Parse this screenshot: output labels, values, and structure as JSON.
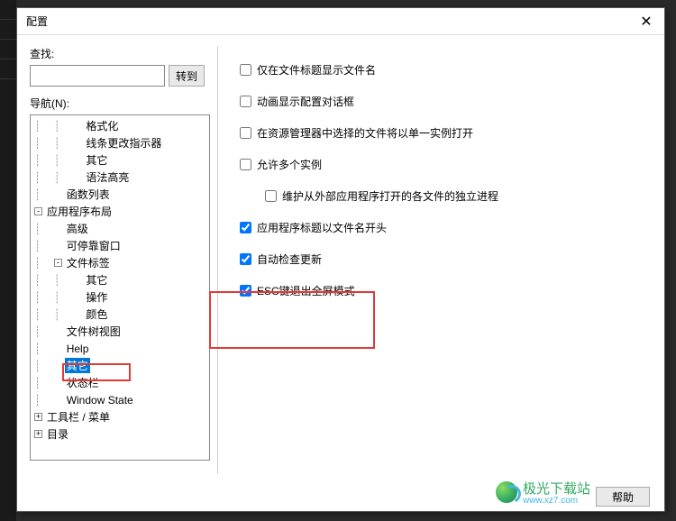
{
  "titlebar": {
    "title": "配置",
    "close": "✕"
  },
  "search": {
    "label": "查找:",
    "goto": "转到"
  },
  "nav": {
    "label": "导航(N):"
  },
  "tree": [
    {
      "level": 2,
      "toggle": "",
      "label": "格式化"
    },
    {
      "level": 2,
      "toggle": "",
      "label": "线条更改指示器"
    },
    {
      "level": 2,
      "toggle": "",
      "label": "其它"
    },
    {
      "level": 2,
      "toggle": "",
      "label": "语法高亮"
    },
    {
      "level": 1,
      "toggle": "",
      "label": "函数列表"
    },
    {
      "level": 0,
      "toggle": "-",
      "label": "应用程序布局"
    },
    {
      "level": 1,
      "toggle": "",
      "label": "高级"
    },
    {
      "level": 1,
      "toggle": "",
      "label": "可停靠窗口"
    },
    {
      "level": 1,
      "toggle": "-",
      "label": "文件标签"
    },
    {
      "level": 2,
      "toggle": "",
      "label": "其它"
    },
    {
      "level": 2,
      "toggle": "",
      "label": "操作"
    },
    {
      "level": 2,
      "toggle": "",
      "label": "颜色"
    },
    {
      "level": 1,
      "toggle": "",
      "label": "文件树视图"
    },
    {
      "level": 1,
      "toggle": "",
      "label": "Help"
    },
    {
      "level": 1,
      "toggle": "",
      "label": "其它",
      "selected": true
    },
    {
      "level": 1,
      "toggle": "",
      "label": "状态栏"
    },
    {
      "level": 1,
      "toggle": "",
      "label": "Window State"
    },
    {
      "level": 0,
      "toggle": "+",
      "label": "工具栏 / 菜单"
    },
    {
      "level": 0,
      "toggle": "+",
      "label": "目录"
    }
  ],
  "options": [
    {
      "checked": false,
      "label": "仅在文件标题显示文件名",
      "indent": false
    },
    {
      "checked": false,
      "label": "动画显示配置对话框",
      "indent": false
    },
    {
      "checked": false,
      "label": "在资源管理器中选择的文件将以单一实例打开",
      "indent": false
    },
    {
      "checked": false,
      "label": "允许多个实例",
      "indent": false
    },
    {
      "checked": false,
      "label": "维护从外部应用程序打开的各文件的独立进程",
      "indent": true
    },
    {
      "checked": true,
      "label": "应用程序标题以文件名开头",
      "indent": false
    },
    {
      "checked": true,
      "label": "自动检查更新",
      "indent": false
    },
    {
      "checked": true,
      "label": "ESC键退出全屏模式",
      "indent": false
    }
  ],
  "footer": {
    "help": "帮助"
  },
  "watermark": {
    "name": "极光下载站",
    "url": "www.xz7.com"
  }
}
